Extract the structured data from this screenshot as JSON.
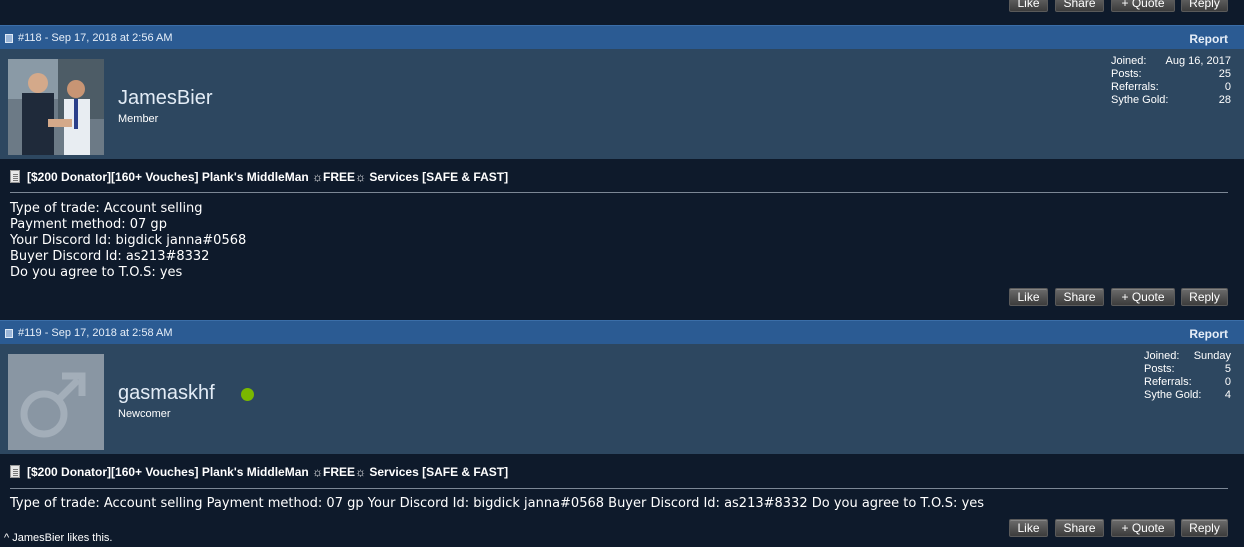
{
  "top_actions": {
    "like": "Like",
    "share": "Share",
    "quote": "+ Quote",
    "reply": "Reply"
  },
  "posts": [
    {
      "meta": "#118 - Sep 17, 2018 at 2:56 AM",
      "report": "Report",
      "username": "JamesBier",
      "user_title": "Member",
      "stats": {
        "joined_label": "Joined:",
        "joined": "Aug 16, 2017",
        "posts_label": "Posts:",
        "posts": "25",
        "referrals_label": "Referrals:",
        "referrals": "0",
        "gold_label": "Sythe Gold:",
        "gold": "28"
      },
      "thread_title": "[$200 Donator][160+ Vouches] Plank's MiddleMan ☼FREE☼ Services [SAFE & FAST]",
      "lines": [
        "Type of trade: Account selling",
        "Payment method: 07 gp",
        "Your Discord Id: bigdick janna#0568",
        "Buyer Discord Id: as213#8332",
        "Do you agree to T.O.S: yes"
      ],
      "actions": {
        "like": "Like",
        "share": "Share",
        "quote": "+ Quote",
        "reply": "Reply"
      }
    },
    {
      "meta": "#119 - Sep 17, 2018 at 2:58 AM",
      "report": "Report",
      "username": "gasmaskhf",
      "online_color": "#7ab800",
      "user_title": "Newcomer",
      "stats": {
        "joined_label": "Joined:",
        "joined": "Sunday",
        "posts_label": "Posts:",
        "posts": "5",
        "referrals_label": "Referrals:",
        "referrals": "0",
        "gold_label": "Sythe Gold:",
        "gold": "4"
      },
      "thread_title": "[$200 Donator][160+ Vouches] Plank's MiddleMan ☼FREE☼ Services [SAFE & FAST]",
      "body": "Type of trade: Account selling Payment method: 07 gp Your Discord Id: bigdick janna#0568 Buyer Discord Id: as213#8332 Do you agree to T.O.S: yes",
      "actions": {
        "like": "Like",
        "share": "Share",
        "quote": "+ Quote",
        "reply": "Reply"
      },
      "likes_text": "^ JamesBier likes this."
    }
  ]
}
